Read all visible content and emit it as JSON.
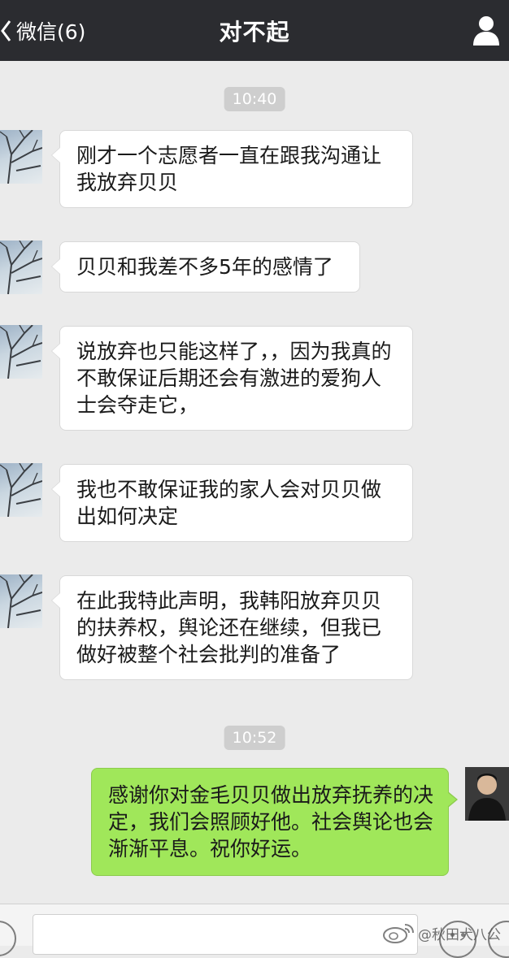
{
  "header": {
    "back_label": "微信(6)",
    "title": "对不起",
    "profile_icon": "person-icon"
  },
  "messages": {
    "time_1": "10:40",
    "time_2": "10:52",
    "in_1": "刚才一个志愿者一直在跟我沟通让我放弃贝贝",
    "in_2": "贝贝和我差不多5年的感情了",
    "in_3": "说放弃也只能这样了，，因为我真的不敢保证后期还会有激进的爱狗人士会夺走它，",
    "in_4": "我也不敢保证我的家人会对贝贝做出如何决定",
    "in_5": "在此我特此声明，我韩阳放弃贝贝的扶养权，舆论还在继续，但我已做好被整个社会批判的准备了",
    "out_1": "感谢你对金毛贝贝做出放弃抚养的决定，我们会照顾好他。社会舆论也会渐渐平息。祝你好运。"
  },
  "watermark": {
    "text": "@秋田犬八公"
  },
  "colors": {
    "header_bg": "#2b2c30",
    "chat_bg": "#ebebeb",
    "incoming_bubble": "#ffffff",
    "outgoing_bubble": "#a0e75a"
  }
}
